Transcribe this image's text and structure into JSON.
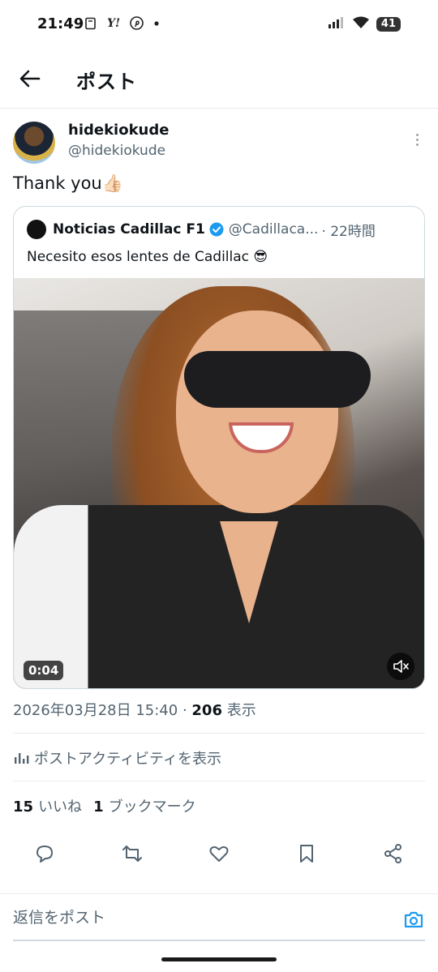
{
  "status_bar": {
    "time": "21:49",
    "left_icons": [
      "notes-icon",
      "yahoo-icon",
      "pinterest-icon",
      "dot-icon"
    ],
    "yahoo_text": "Y!",
    "battery": "41"
  },
  "header": {
    "title": "ポスト"
  },
  "post": {
    "author_name": "hidekiokude",
    "author_handle": "@hidekiokude",
    "text": "Thank you👍🏻",
    "timestamp": "2026年03月28日 15:40",
    "separator": " · ",
    "views_count": "206",
    "views_label": " 表示",
    "activity_label": "ポストアクティビティを表示",
    "likes_count": "15",
    "likes_label": "いいね",
    "bookmarks_count": "1",
    "bookmarks_label": "ブックマーク"
  },
  "quote": {
    "name": "Noticias Cadillac F1",
    "handle": "@Cadillaca...",
    "time": "· 22時間",
    "text": "Necesito esos lentes de Cadillac 😎",
    "video_duration": "0:04"
  },
  "actions": [
    "reply-icon",
    "retweet-icon",
    "like-icon",
    "bookmark-icon",
    "share-icon"
  ],
  "reply": {
    "placeholder": "返信をポスト"
  },
  "colors": {
    "text_primary": "#0f1419",
    "text_secondary": "#536471",
    "accent": "#1d9bf0",
    "border": "#cfd9de"
  }
}
